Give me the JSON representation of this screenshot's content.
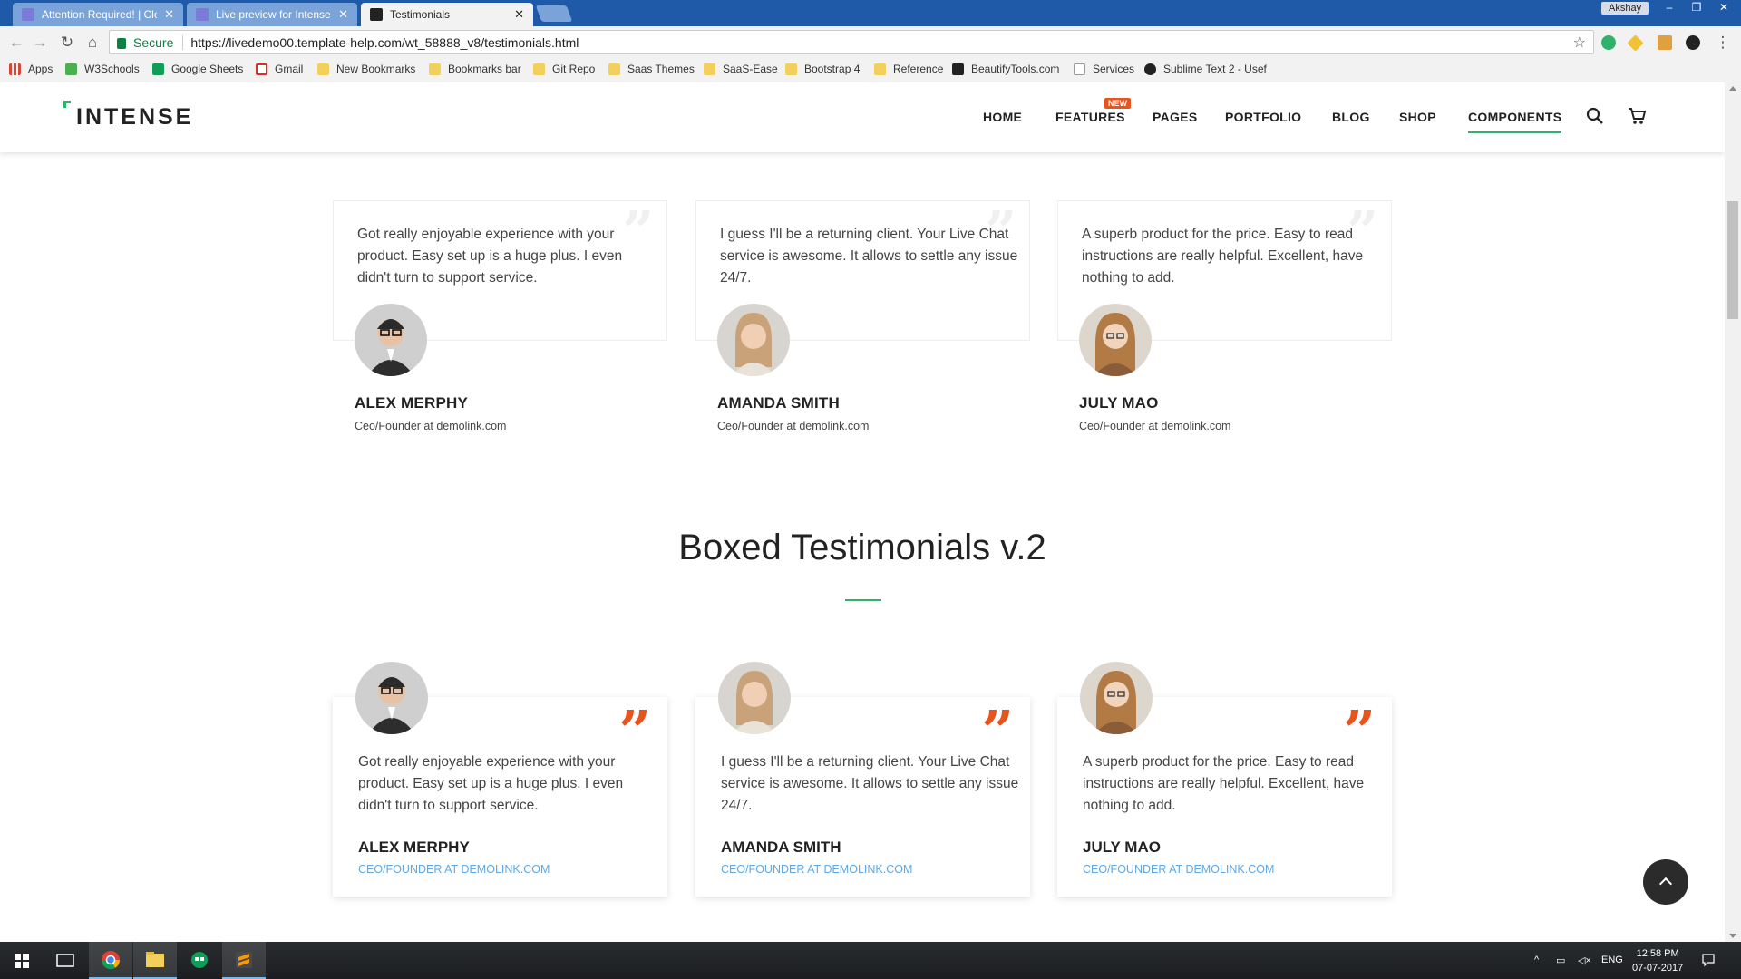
{
  "browser": {
    "tabs": [
      {
        "label": "Attention Required! | Clo",
        "favicon_color": "#7b7bd9"
      },
      {
        "label": "Live preview for Intense I",
        "favicon_color": "#7b7bd9"
      },
      {
        "label": "Testimonials",
        "favicon_color": "#222222"
      }
    ],
    "user": "Akshay",
    "window_controls": [
      "–",
      "❐",
      "✕"
    ],
    "secure_label": "Secure",
    "url": "https://livedemo00.template-help.com/wt_58888_v8/testimonials.html",
    "bookmarks": [
      {
        "label": "Apps",
        "icon": "apps-grid-icon"
      },
      {
        "label": "W3Schools",
        "icon": "w3schools-icon"
      },
      {
        "label": "Google Sheets",
        "icon": "sheets-icon"
      },
      {
        "label": "Gmail",
        "icon": "gmail-icon"
      },
      {
        "label": "New Bookmarks",
        "icon": "folder-icon"
      },
      {
        "label": "Bookmarks bar",
        "icon": "folder-icon"
      },
      {
        "label": "Git Repo",
        "icon": "folder-icon"
      },
      {
        "label": "Saas Themes",
        "icon": "folder-icon"
      },
      {
        "label": "SaaS-Ease",
        "icon": "folder-icon"
      },
      {
        "label": "Bootstrap 4",
        "icon": "folder-icon"
      },
      {
        "label": "Reference",
        "icon": "folder-icon"
      },
      {
        "label": "BeautifyTools.com",
        "icon": "bt-icon"
      },
      {
        "label": "Services",
        "icon": "t-icon"
      },
      {
        "label": "Sublime Text 2 - Usef",
        "icon": "github-icon"
      }
    ]
  },
  "site": {
    "logo": "INTENSE",
    "nav": [
      "HOME",
      "FEATURES",
      "PAGES",
      "PORTFOLIO",
      "BLOG",
      "SHOP",
      "COMPONENTS"
    ],
    "new_badge": "NEW",
    "active_nav": "COMPONENTS",
    "accent": "#2fb36b",
    "quote_color": "#e8541e"
  },
  "testimonials_v1": [
    {
      "text": "Got really enjoyable experience with your product. Easy set up is a huge plus. I even didn't turn to support service.",
      "name": "ALEX MERPHY",
      "role": "Ceo/Founder at demolink.com"
    },
    {
      "text": "I guess I'll be a returning client. Your Live Chat service is awesome. It allows to settle any issue 24/7.",
      "name": "AMANDA SMITH",
      "role": "Ceo/Founder at demolink.com"
    },
    {
      "text": "A superb product for the price. Easy to read instructions are really helpful. Excellent, have nothing to add.",
      "name": "JULY MAO",
      "role": "Ceo/Founder at demolink.com"
    }
  ],
  "section2_title": "Boxed Testimonials v.2",
  "testimonials_v2": [
    {
      "text": "Got really enjoyable experience with your product. Easy set up is a huge plus. I even didn't turn to support service.",
      "name": "ALEX MERPHY",
      "role": "CEO/FOUNDER AT DEMOLINK.COM"
    },
    {
      "text": "I guess I'll be a returning client. Your Live Chat service is awesome. It allows to settle any issue 24/7.",
      "name": "AMANDA SMITH",
      "role": "CEO/FOUNDER AT DEMOLINK.COM"
    },
    {
      "text": "A superb product for the price. Easy to read instructions are really helpful. Excellent, have nothing to add.",
      "name": "JULY MAO",
      "role": "CEO/FOUNDER AT DEMOLINK.COM"
    }
  ],
  "taskbar": {
    "lang": "ENG",
    "time": "12:58 PM",
    "date": "07-07-2017"
  }
}
